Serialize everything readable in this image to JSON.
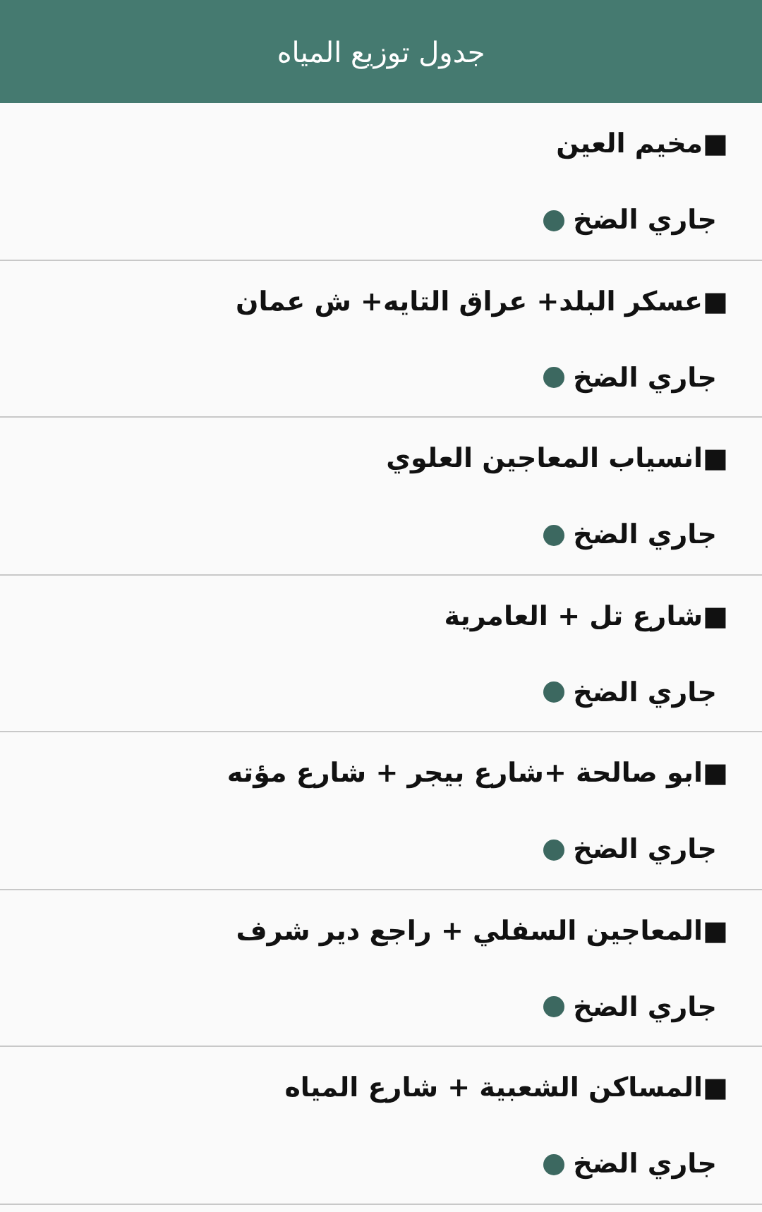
{
  "app_bar": {
    "title": "جدول توزيع المياه"
  },
  "areas": [
    {
      "name": "■مخيم العين",
      "status": "جاري الضخ",
      "color": "#3c6860"
    },
    {
      "name": "■عسكر البلد+ عراق التايه+ ش عمان",
      "status": "جاري الضخ",
      "color": "#3c6860"
    },
    {
      "name": "■انسياب المعاجين العلوي",
      "status": "جاري الضخ",
      "color": "#3c6860"
    },
    {
      "name": "■شارع تل + العامرية",
      "status": "جاري الضخ",
      "color": "#3c6860"
    },
    {
      "name": "■ابو صالحة +شارع بيجر + شارع مؤته",
      "status": "جاري الضخ",
      "color": "#3c6860"
    },
    {
      "name": "■المعاجين السفلي + راجع دير شرف",
      "status": "جاري الضخ",
      "color": "#3c6860"
    },
    {
      "name": "■المساكن الشعبية + شارع المياه",
      "status": "جاري الضخ",
      "color": "#3c6860"
    }
  ]
}
